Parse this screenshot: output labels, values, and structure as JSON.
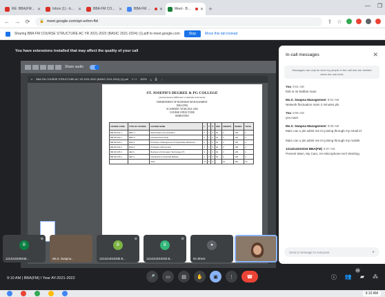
{
  "browser": {
    "tabs": [
      {
        "label": "RE: BBA(FM) I Year AY-2021-22",
        "color": "#d93025",
        "active": false
      },
      {
        "label": "Inbox (1) - bulusaiswetha",
        "color": "#d93025",
        "active": false
      },
      {
        "label": "BBA FM COURSE STRUCTURE",
        "color": "#d93025",
        "active": false
      },
      {
        "label": "BBA FM COURSE STRUCTURE",
        "color": "#4285f4",
        "active": false,
        "recording": true
      },
      {
        "label": "Meet - BBA(FM) I Yea",
        "color": "#188038",
        "active": true,
        "recording": true
      }
    ],
    "new_tab": "+",
    "url": "meet.google.com/qzi-ezhm-ftd"
  },
  "share_banner": {
    "text": "Sharing BBA FM COURSE STRUCTURE AC YR 2021-2022 (BASIC 2021-2024) (1).pdf to meet.google.com",
    "stop_label": "Stop",
    "hide_label": "Move this tab instead"
  },
  "meet": {
    "warning": "You have extensions installed that may affect the quality of your call",
    "share_audio_label": "Share audio",
    "pdf": {
      "toolbar_title": "BBA FM COURSE STRUCTURE AC YR 2021-2022 (BASIC 2021-2024) (1).pdf",
      "page_counter": "1 / 1",
      "zoom": "100%",
      "college": "ST. JOSEPH'S DEGREE & PG COLLEGE",
      "affiliation": "(Autonomous) Affiliated to Osmania University",
      "department": "DEPARTMENT OF BUSINESS MANAGEMENT",
      "program": "BBA (FM)",
      "academic_year": "ACADEMIC YEAR 2021-2022",
      "structure": "COURSE STRUCTURE",
      "semester": "SEMESTER I",
      "table": {
        "headers": [
          "COURSE CODE",
          "TYPE OF COURSE",
          "COURSE NAME",
          "L",
          "T",
          "P",
          "HRS",
          "CREDITS",
          "MARKS",
          "TOTAL"
        ],
        "rows": [
          [
            "BM.FM.101.1",
            "MDC-1",
            "World Class Communication",
            "3",
            "1",
            "0",
            "40",
            "4",
            "100",
            "4"
          ],
          [
            "BM.FM.102.1",
            "MDC-2",
            "Financial Accounting",
            "3",
            "1",
            "0",
            "40",
            "4",
            "100",
            "4"
          ],
          [
            "BM.FM.103.1",
            "DSC-1",
            "Principles of Management & Organization Behaviour",
            "3",
            "1",
            "0",
            "40",
            "4",
            "100",
            "4"
          ],
          [
            "BM.FM.104.1",
            "DSC-2",
            "Principles of Economics",
            "3",
            "1",
            "0",
            "40",
            "4",
            "100",
            "4"
          ],
          [
            "BM.FM.105.1",
            "AECC",
            "Business of Information Technology (IT)",
            "3",
            "1",
            "0",
            "40",
            "4",
            "100",
            "4"
          ],
          [
            "BM.FM.106.1",
            "SEC-1",
            "Introduction to Financial Markets",
            "2",
            "0",
            "0",
            "40",
            "2",
            "100",
            "2"
          ],
          [
            "",
            "",
            "Total",
            "17",
            "5",
            "0",
            "",
            "22",
            "600",
            "22"
          ]
        ]
      }
    },
    "tiles": [
      {
        "type": "avatar",
        "initial": "B",
        "color": "#0b8043",
        "name": "1214210400348...",
        "muted": true
      },
      {
        "type": "photo",
        "name": "Ms.S. Swapna...",
        "muted": false
      },
      {
        "type": "avatar",
        "initial": "B",
        "color": "#7cb342",
        "name": "1214214010335 B...",
        "muted": true
      },
      {
        "type": "avatar",
        "initial": "B",
        "color": "#33b679",
        "name": "1214214010333 B...",
        "muted": true
      },
      {
        "type": "others",
        "name": "94 others",
        "muted": false
      },
      {
        "type": "self",
        "name": "",
        "muted": false
      }
    ],
    "controls": {
      "time": "9:10 AM",
      "meeting_name": "BBA(FM) I Year AY-2021-2022",
      "participant_count": "99"
    }
  },
  "chat": {
    "title": "In-call messages",
    "note": "Messages can only be seen by people in the call and are deleted when the call ends",
    "messages": [
      {
        "sender": "You",
        "time": "9:01 AM",
        "text": "hiiiii in mt bebbie mam"
      },
      {
        "sender": "Ms.S. Swapna Management",
        "time": "9:02 AM",
        "text": "Network fluctuation mam 2 minutes pls"
      },
      {
        "sender": "You",
        "time": "9:05 AM",
        "text": "yes mam"
      },
      {
        "sender": "Ms.S. Swapna Management",
        "time": "9:05 AM",
        "text": "Mam can u pls admit me im joining through my email id"
      },
      {
        "sender": "",
        "time": "",
        "text": "Mam can u pls admit me im joining through my mobile"
      },
      {
        "sender": "1214214010316 BBA(FM)",
        "time": "9:07 AM",
        "text": "Present Mam, My Cam, Am Microphone Isn't Working"
      }
    ],
    "input_placeholder": "Send a message to everyone"
  },
  "taskbar": {
    "icons": [
      "#4285f4",
      "#ea4335",
      "#34a853",
      "#fbbc04",
      "#4285f4"
    ],
    "tray": "9:10 AM"
  }
}
